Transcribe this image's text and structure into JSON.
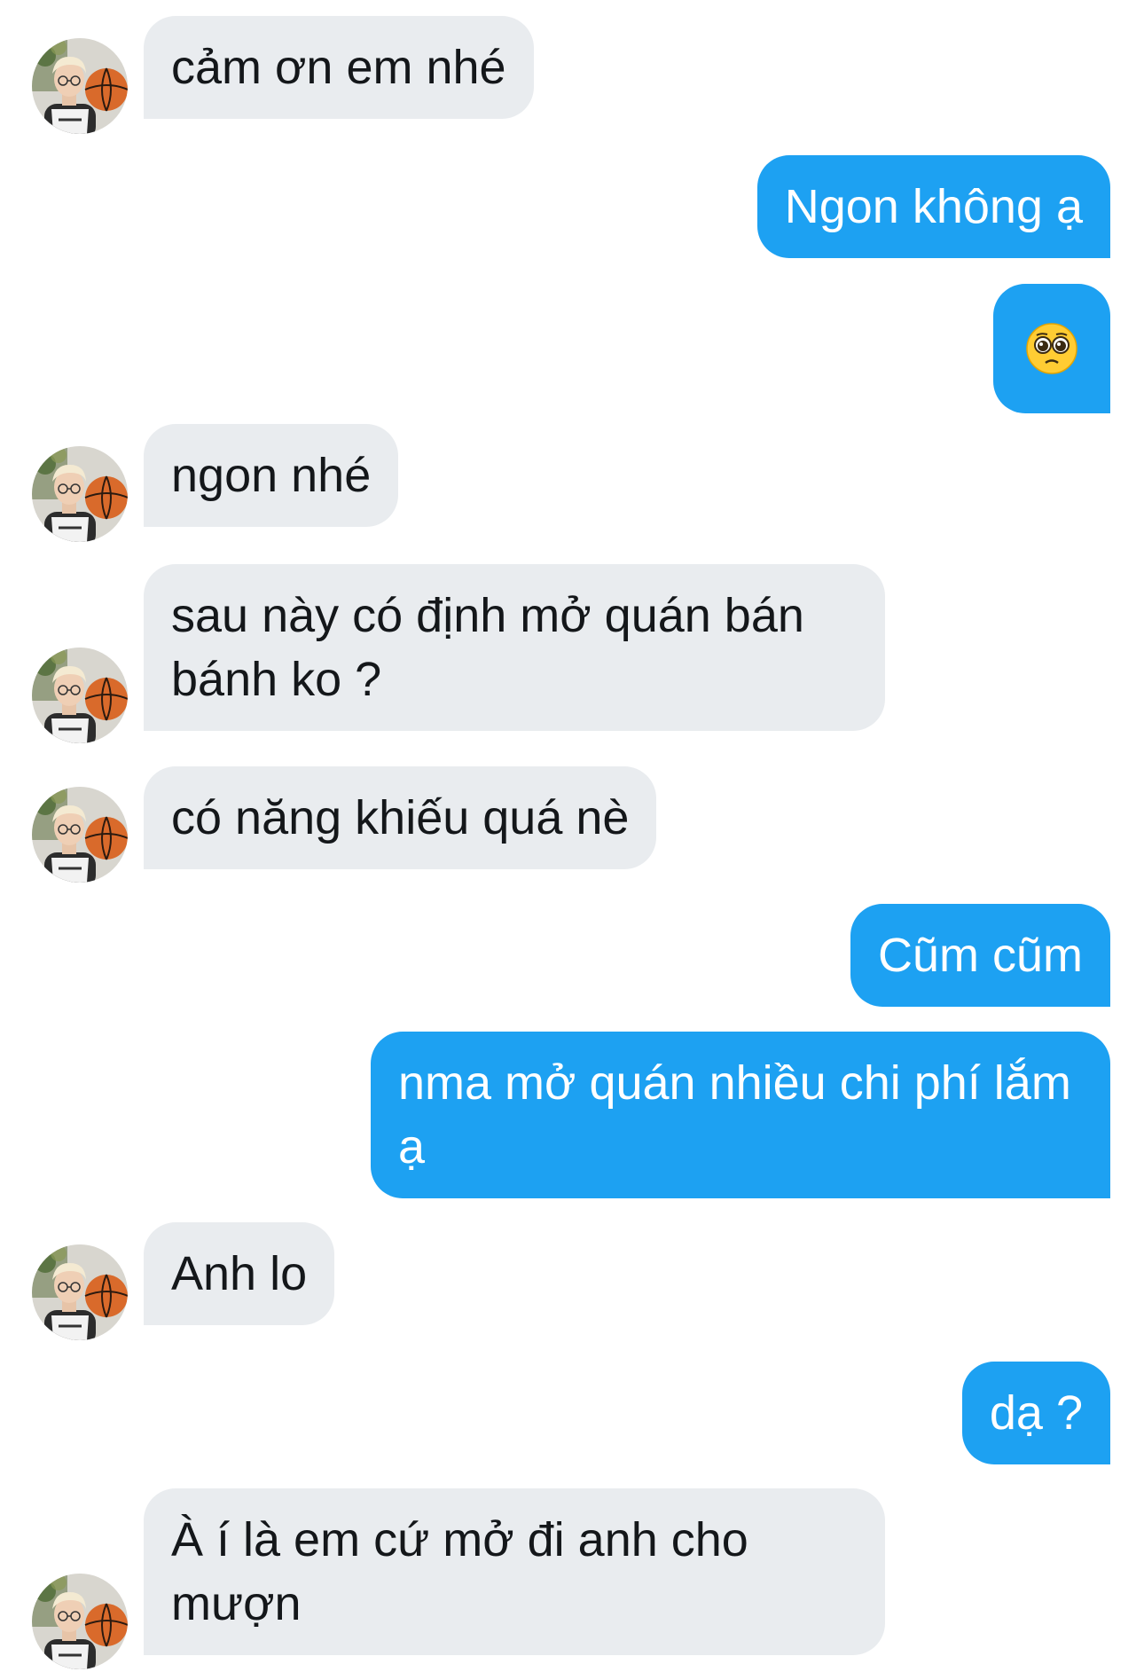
{
  "conversation": {
    "messages": [
      {
        "side": "received",
        "text": "cảm ơn em nhé"
      },
      {
        "side": "sent",
        "text": "Ngon không ạ"
      },
      {
        "side": "sent",
        "emoji": "pleading-face-emoji"
      },
      {
        "side": "received",
        "text": "ngon nhé"
      },
      {
        "side": "received",
        "text": "sau này có định mở quán bán bánh ko ?"
      },
      {
        "side": "received",
        "text": "có năng khiếu quá nè"
      },
      {
        "side": "sent",
        "text": "Cũm cũm"
      },
      {
        "side": "sent",
        "text": "nma mở quán nhiều chi phí lắm ạ"
      },
      {
        "side": "received",
        "text": "Anh lo"
      },
      {
        "side": "sent",
        "text": "dạ ?"
      },
      {
        "side": "received",
        "text": "À í là em cứ mở đi anh cho mượn"
      }
    ]
  },
  "colors": {
    "sent_bubble": "#1da1f2",
    "received_bubble": "#e9ecef",
    "received_text": "#14171a",
    "sent_text": "#ffffff"
  }
}
